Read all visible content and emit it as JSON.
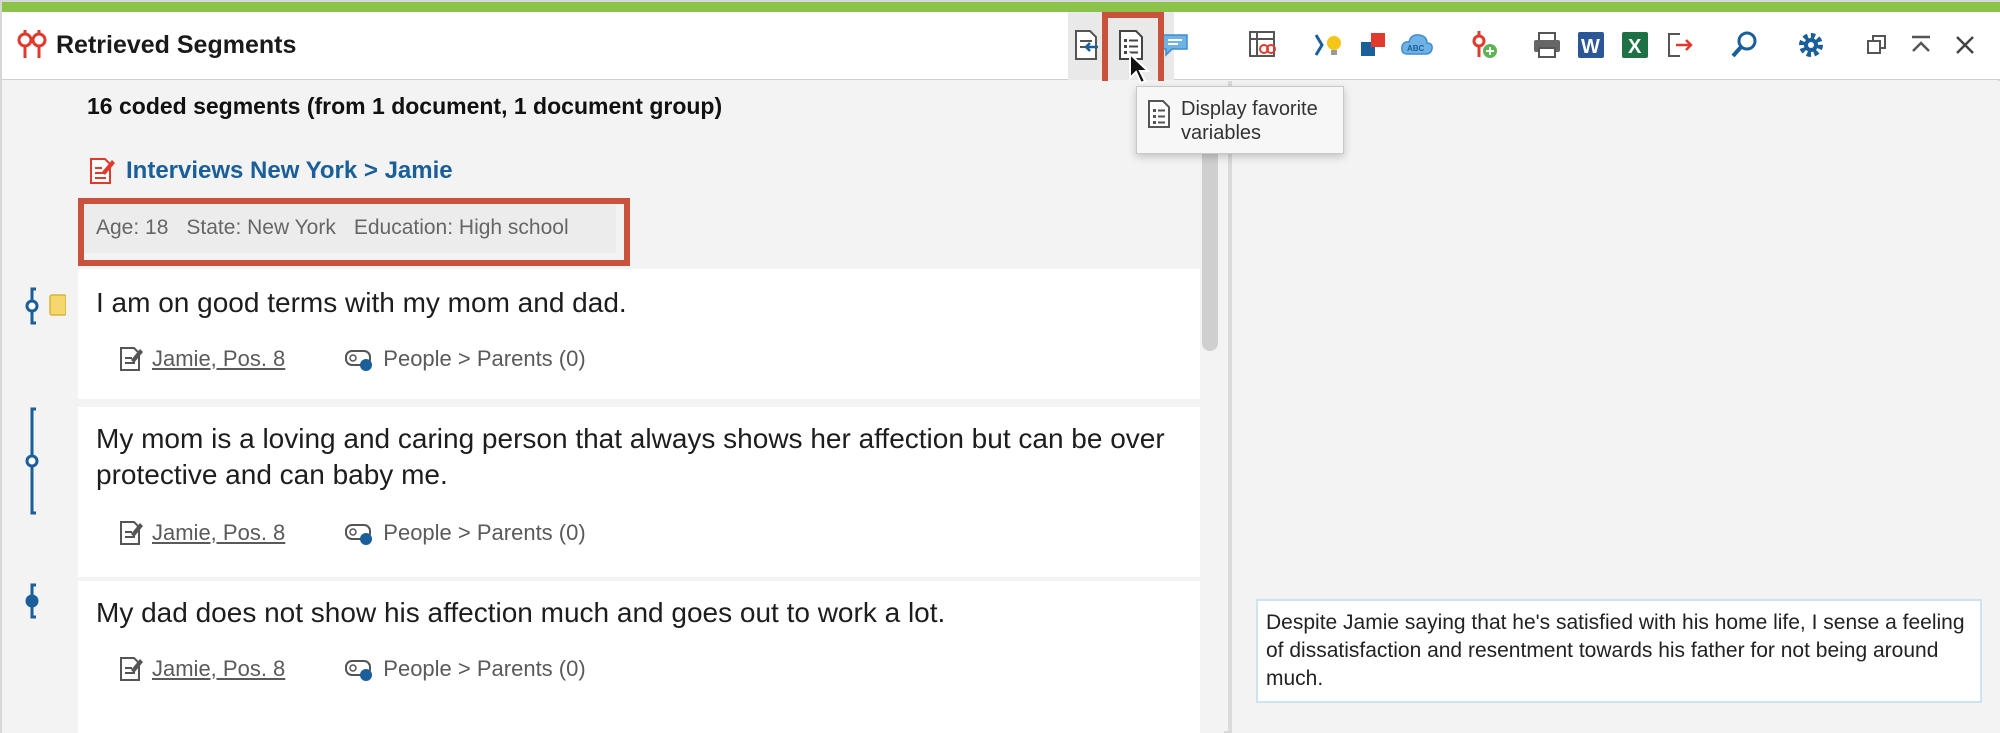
{
  "window": {
    "title": "Retrieved Segments",
    "accent_color": "#8bc34a",
    "highlight_color": "#c9533a"
  },
  "toolbar": {
    "icons": [
      "export-to-document-icon",
      "display-favorite-variables-icon",
      "comments-icon",
      "code-matrix-icon",
      "smart-coding-icon",
      "color-codes-icon",
      "word-cloud-icon",
      "add-code-icon",
      "print-icon",
      "word-export-icon",
      "excel-export-icon",
      "export-icon",
      "search-icon",
      "settings-icon",
      "undock-icon",
      "collapse-icon",
      "close-icon"
    ]
  },
  "tooltip": {
    "text": "Display favorite variables"
  },
  "summary": "16 coded segments (from 1 document, 1 document group)",
  "document": {
    "link": "Interviews New York > Jamie"
  },
  "variables": [
    "Age: 18",
    "State: New York",
    "Education: High school"
  ],
  "segments": [
    {
      "text": "I am on good terms with my mom and dad.",
      "doc_ref": "Jamie, Pos. 8",
      "code": "People > Parents (0)"
    },
    {
      "text": "My mom is a loving and caring person that always shows her affection but can be over protective and can baby me.",
      "doc_ref": "Jamie, Pos. 8",
      "code": "People > Parents (0)"
    },
    {
      "text": "My dad does not show his affection much and goes out to work a lot.",
      "doc_ref": "Jamie, Pos. 8",
      "code": "People > Parents (0)"
    }
  ],
  "memo": {
    "text": "Despite Jamie saying that he's satisfied with his home life, I sense a feeling of dissatisfaction and resentment towards his father for not being around much."
  }
}
